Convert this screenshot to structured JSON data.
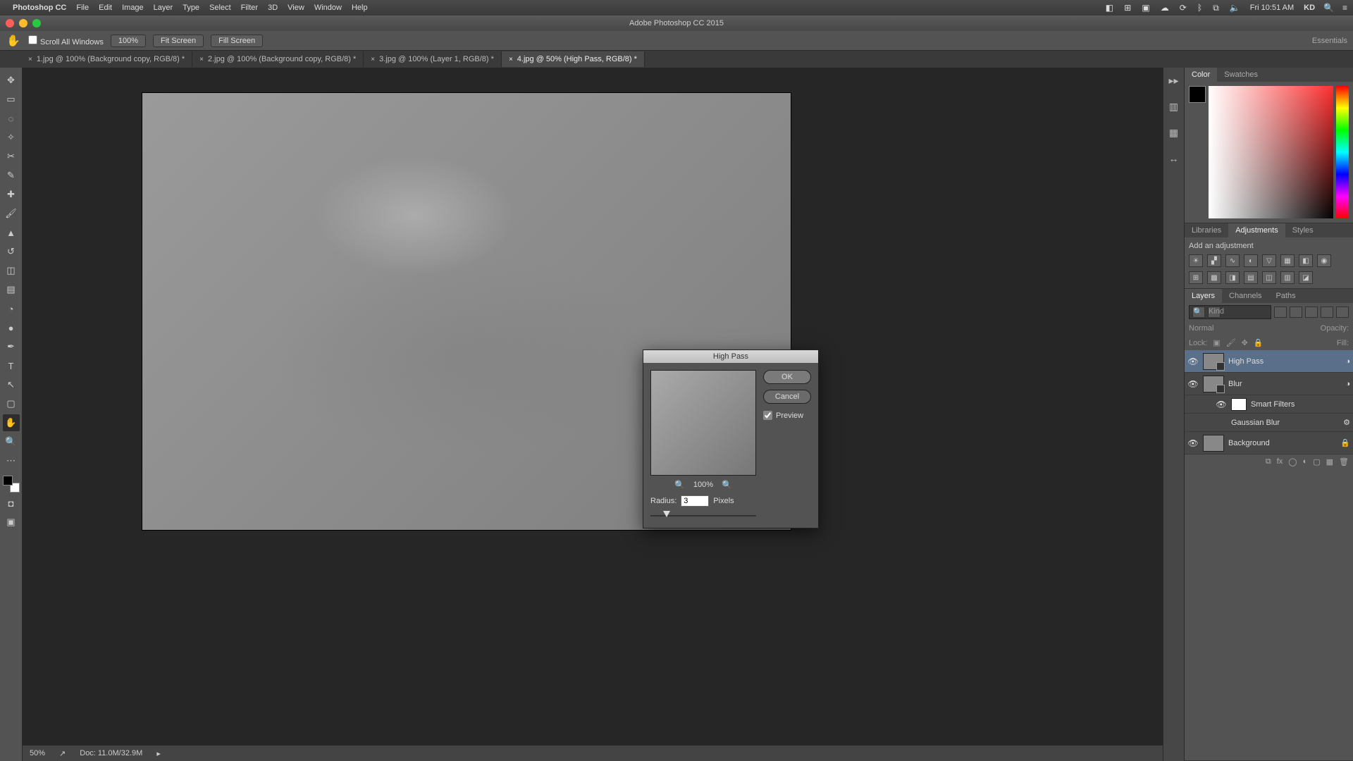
{
  "menubar": {
    "app": "Photoshop CC",
    "items": [
      "File",
      "Edit",
      "Image",
      "Layer",
      "Type",
      "Select",
      "Filter",
      "3D",
      "View",
      "Window",
      "Help"
    ],
    "clock": "Fri 10:51 AM",
    "user": "KD"
  },
  "window_title": "Adobe Photoshop CC 2015",
  "options": {
    "scroll_all": "Scroll All Windows",
    "zoom_pct": "100%",
    "fit_screen": "Fit Screen",
    "fill_screen": "Fill Screen",
    "workspace": "Essentials"
  },
  "tabs": [
    {
      "label": "1.jpg @ 100% (Background copy, RGB/8) *",
      "active": false
    },
    {
      "label": "2.jpg @ 100% (Background copy, RGB/8) *",
      "active": false
    },
    {
      "label": "3.jpg @ 100% (Layer 1, RGB/8) *",
      "active": false
    },
    {
      "label": "4.jpg @ 50% (High Pass, RGB/8) *",
      "active": true
    }
  ],
  "status": {
    "zoom": "50%",
    "doc": "Doc: 11.0M/32.9M"
  },
  "panels": {
    "color_tabs": [
      "Color",
      "Swatches"
    ],
    "adj_tabs": [
      "Libraries",
      "Adjustments",
      "Styles"
    ],
    "adj_hint": "Add an adjustment",
    "layer_tabs": [
      "Layers",
      "Channels",
      "Paths"
    ],
    "blend_mode": "Normal",
    "opacity_label": "Opacity:",
    "lock_label": "Lock:",
    "fill_label": "Fill:",
    "kind_label": "Kind",
    "layers": [
      {
        "name": "High Pass",
        "sel": true,
        "smart": true
      },
      {
        "name": "Blur",
        "sel": false,
        "smart": true
      },
      {
        "name": "Smart Filters",
        "sel": false,
        "sub": true,
        "white": true
      },
      {
        "name": "Gaussian Blur",
        "sel": false,
        "sub": true,
        "filter": true
      },
      {
        "name": "Background",
        "sel": false
      }
    ]
  },
  "dialog": {
    "title": "High Pass",
    "ok": "OK",
    "cancel": "Cancel",
    "preview": "Preview",
    "zoom": "100%",
    "radius_label": "Radius:",
    "radius_value": "3",
    "radius_unit": "Pixels"
  }
}
